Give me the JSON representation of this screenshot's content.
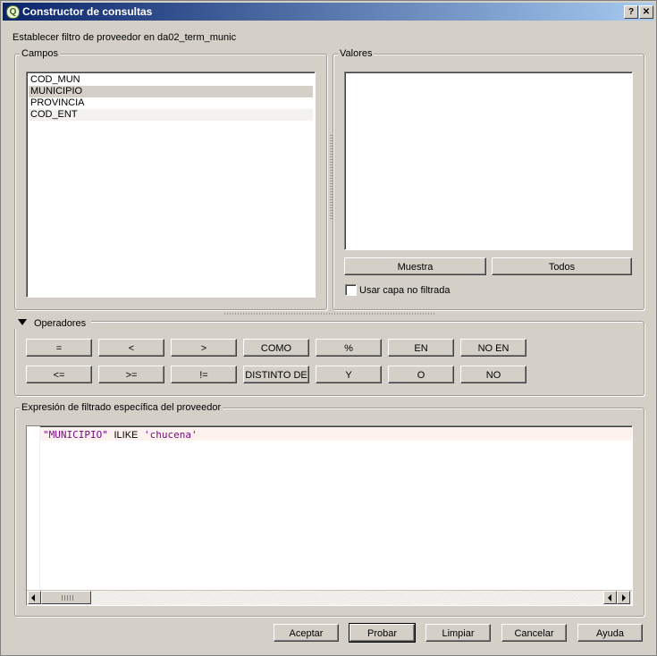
{
  "window": {
    "title": "Constructor de consultas",
    "help_btn": "?",
    "close_btn": "✕"
  },
  "provider_filter_label": "Establecer filtro de proveedor en da02_term_munic",
  "fields": {
    "title": "Campos",
    "items": [
      "COD_MUN",
      "MUNICIPIO",
      "PROVINCIA",
      "COD_ENT"
    ]
  },
  "values": {
    "title": "Valores",
    "sample_btn": "Muestra",
    "all_btn": "Todos",
    "unfiltered_label": "Usar capa no filtrada"
  },
  "operators": {
    "title": "Operadores",
    "row1": [
      "=",
      "<",
      ">",
      "COMO",
      "%",
      "EN",
      "NO EN"
    ],
    "row2": [
      "<=",
      ">=",
      "!=",
      "DISTINTO DE",
      "Y",
      "O",
      "NO"
    ]
  },
  "expression": {
    "title": "Expresión de filtrado específica del proveedor",
    "field": "\"MUNICIPIO\"",
    "keyword": "ILIKE",
    "value": "'chucena'"
  },
  "buttons": {
    "ok": "Aceptar",
    "test": "Probar",
    "clear": "Limpiar",
    "cancel": "Cancelar",
    "help": "Ayuda"
  }
}
